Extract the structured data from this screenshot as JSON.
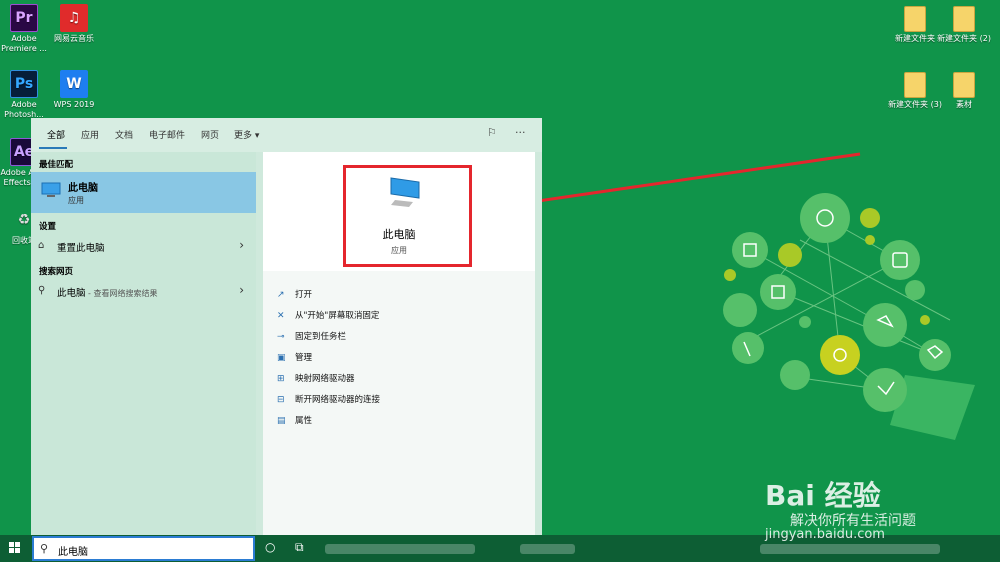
{
  "desktop": {
    "left_icons": [
      {
        "label": "Adobe Premiere ...",
        "glyph": "Pr"
      },
      {
        "label": "网易云音乐",
        "glyph": "♫"
      },
      {
        "label": "Adobe Photosh...",
        "glyph": "Ps"
      },
      {
        "label": "WPS 2019",
        "glyph": "W"
      },
      {
        "label": "Adobe After Effects CC",
        "glyph": "Ae"
      },
      {
        "label": "回收站",
        "glyph": "♻"
      }
    ],
    "right_icons": [
      {
        "label": "新建文件夹"
      },
      {
        "label": "新建文件夹 (2)"
      },
      {
        "label": "新建文件夹 (3)"
      },
      {
        "label": "素材"
      }
    ]
  },
  "start_menu": {
    "tabs": [
      "全部",
      "应用",
      "文档",
      "电子邮件",
      "网页",
      "更多 ▾"
    ],
    "tab_icons": {
      "feedback": "feedback-icon",
      "more": "···"
    },
    "best_match_header": "最佳匹配",
    "best_match": {
      "title": "此电脑",
      "subtitle": "应用"
    },
    "settings_header": "设置",
    "settings_item": "重置此电脑",
    "web_header": "搜索网页",
    "web_item": {
      "title": "此电脑",
      "subtitle": " - 查看网络搜索结果"
    },
    "preview": {
      "title": "此电脑",
      "subtitle": "应用"
    },
    "actions": [
      "打开",
      "从\"开始\"屏幕取消固定",
      "固定到任务栏",
      "管理",
      "映射网络驱动器",
      "断开网络驱动器的连接",
      "属性"
    ]
  },
  "taskbar": {
    "search_value": "此电脑"
  },
  "watermark": {
    "brand": "Bai 经验",
    "slogan": "解决你所有生活问题",
    "url": "jingyan.baidu.com"
  },
  "colors": {
    "desktop": "#10944a",
    "highlight_box": "#e4262d",
    "selection": "#89c7e4",
    "accent": "#2b7cd3"
  }
}
